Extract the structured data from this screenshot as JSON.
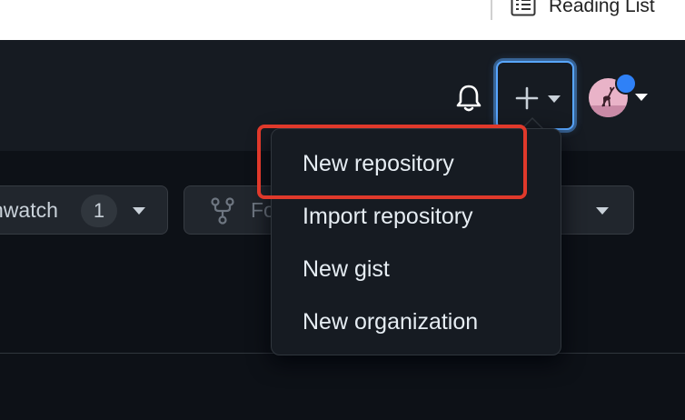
{
  "browser": {
    "reading_list_label": "Reading List"
  },
  "header": {
    "notification_icon": "bell-icon",
    "create_icon": "plus-icon",
    "avatar_status_color": "#2f81f7"
  },
  "repo_actions": {
    "unwatch_label": "nwatch",
    "watch_count": "1",
    "fork_label": "Fo"
  },
  "create_menu": {
    "items": [
      {
        "label": "New repository"
      },
      {
        "label": "Import repository"
      },
      {
        "label": "New gist"
      },
      {
        "label": "New organization"
      }
    ]
  },
  "annotation": {
    "highlight_color": "#e0392b",
    "highlighted_item": "New repository"
  },
  "colors": {
    "accent": "#58a6ff",
    "header_bg": "#161b22",
    "page_bg": "#0d1117"
  }
}
